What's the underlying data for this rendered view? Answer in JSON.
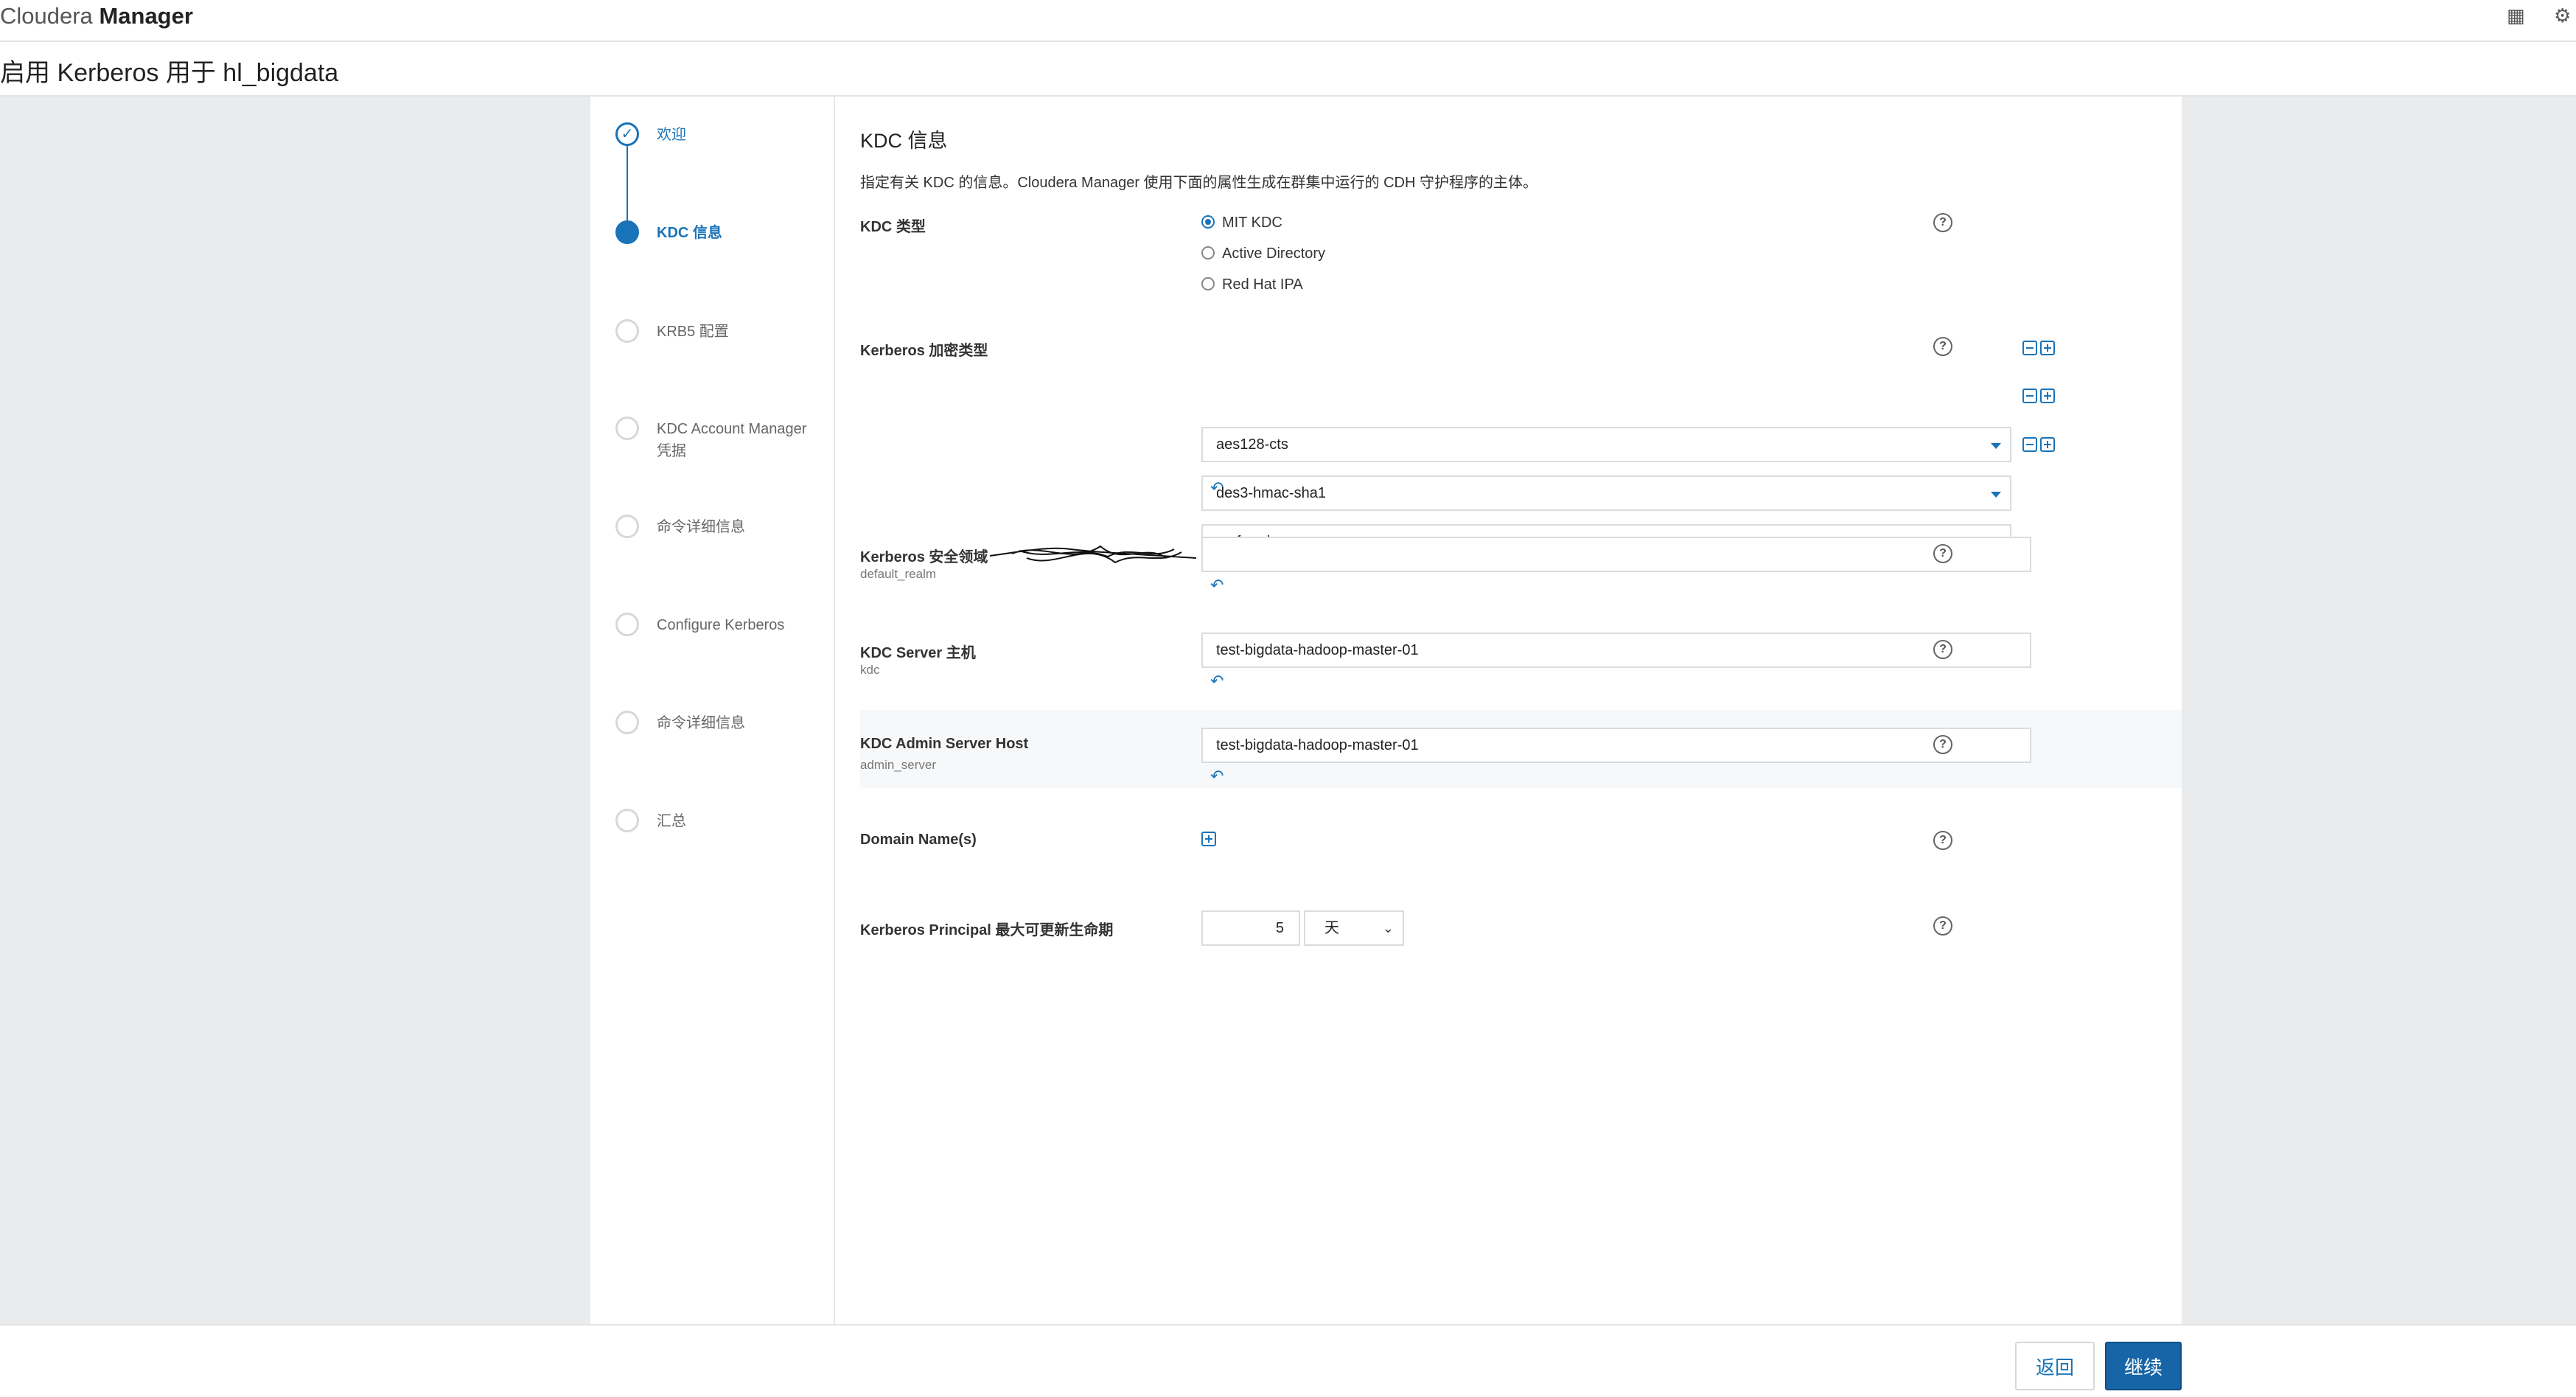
{
  "app": {
    "brand_light": "Cloudera",
    "brand_bold": "Manager"
  },
  "page_title": "启用 Kerberos 用于 hl_bigdata",
  "steps": [
    {
      "label": "欢迎",
      "state": "done"
    },
    {
      "label": "KDC 信息",
      "state": "active"
    },
    {
      "label": "KRB5 配置",
      "state": "todo"
    },
    {
      "label": "KDC Account Manager 凭据",
      "state": "todo"
    },
    {
      "label": "命令详细信息",
      "state": "todo"
    },
    {
      "label": "Configure Kerberos",
      "state": "todo"
    },
    {
      "label": "命令详细信息",
      "state": "todo"
    },
    {
      "label": "汇总",
      "state": "todo"
    }
  ],
  "main": {
    "title": "KDC 信息",
    "description": "指定有关 KDC 的信息。Cloudera Manager 使用下面的属性生成在群集中运行的 CDH 守护程序的主体。",
    "kdc_type": {
      "label": "KDC 类型",
      "options": [
        "MIT KDC",
        "Active Directory",
        "Red Hat IPA"
      ],
      "selected": "MIT KDC"
    },
    "enc_types": {
      "label": "Kerberos 加密类型",
      "values": [
        "aes128-cts",
        "des3-hmac-sha1",
        "arcfour-hmac"
      ]
    },
    "realm": {
      "label": "Kerberos 安全领域",
      "sub": "default_realm",
      "value": ""
    },
    "kdc_server": {
      "label": "KDC Server 主机",
      "sub": "kdc",
      "value": "test-bigdata-hadoop-master-01"
    },
    "admin_server": {
      "label": "KDC Admin Server Host",
      "sub": "admin_server",
      "value": "test-bigdata-hadoop-master-01"
    },
    "domain_names": {
      "label": "Domain Name(s)"
    },
    "renew_lifetime": {
      "label": "Kerberos Principal 最大可更新生命期",
      "value": "5",
      "unit": "天"
    }
  },
  "footer": {
    "back_label": "返回",
    "next_label": "继续"
  },
  "colors": {
    "accent": "#1973b8",
    "primary_button": "#1765a6"
  },
  "icons": {
    "help": "question-circle-icon",
    "undo": "undo-arrow-icon",
    "add": "plus-box-icon",
    "remove": "minus-box-icon",
    "done": "check-circle-icon"
  }
}
